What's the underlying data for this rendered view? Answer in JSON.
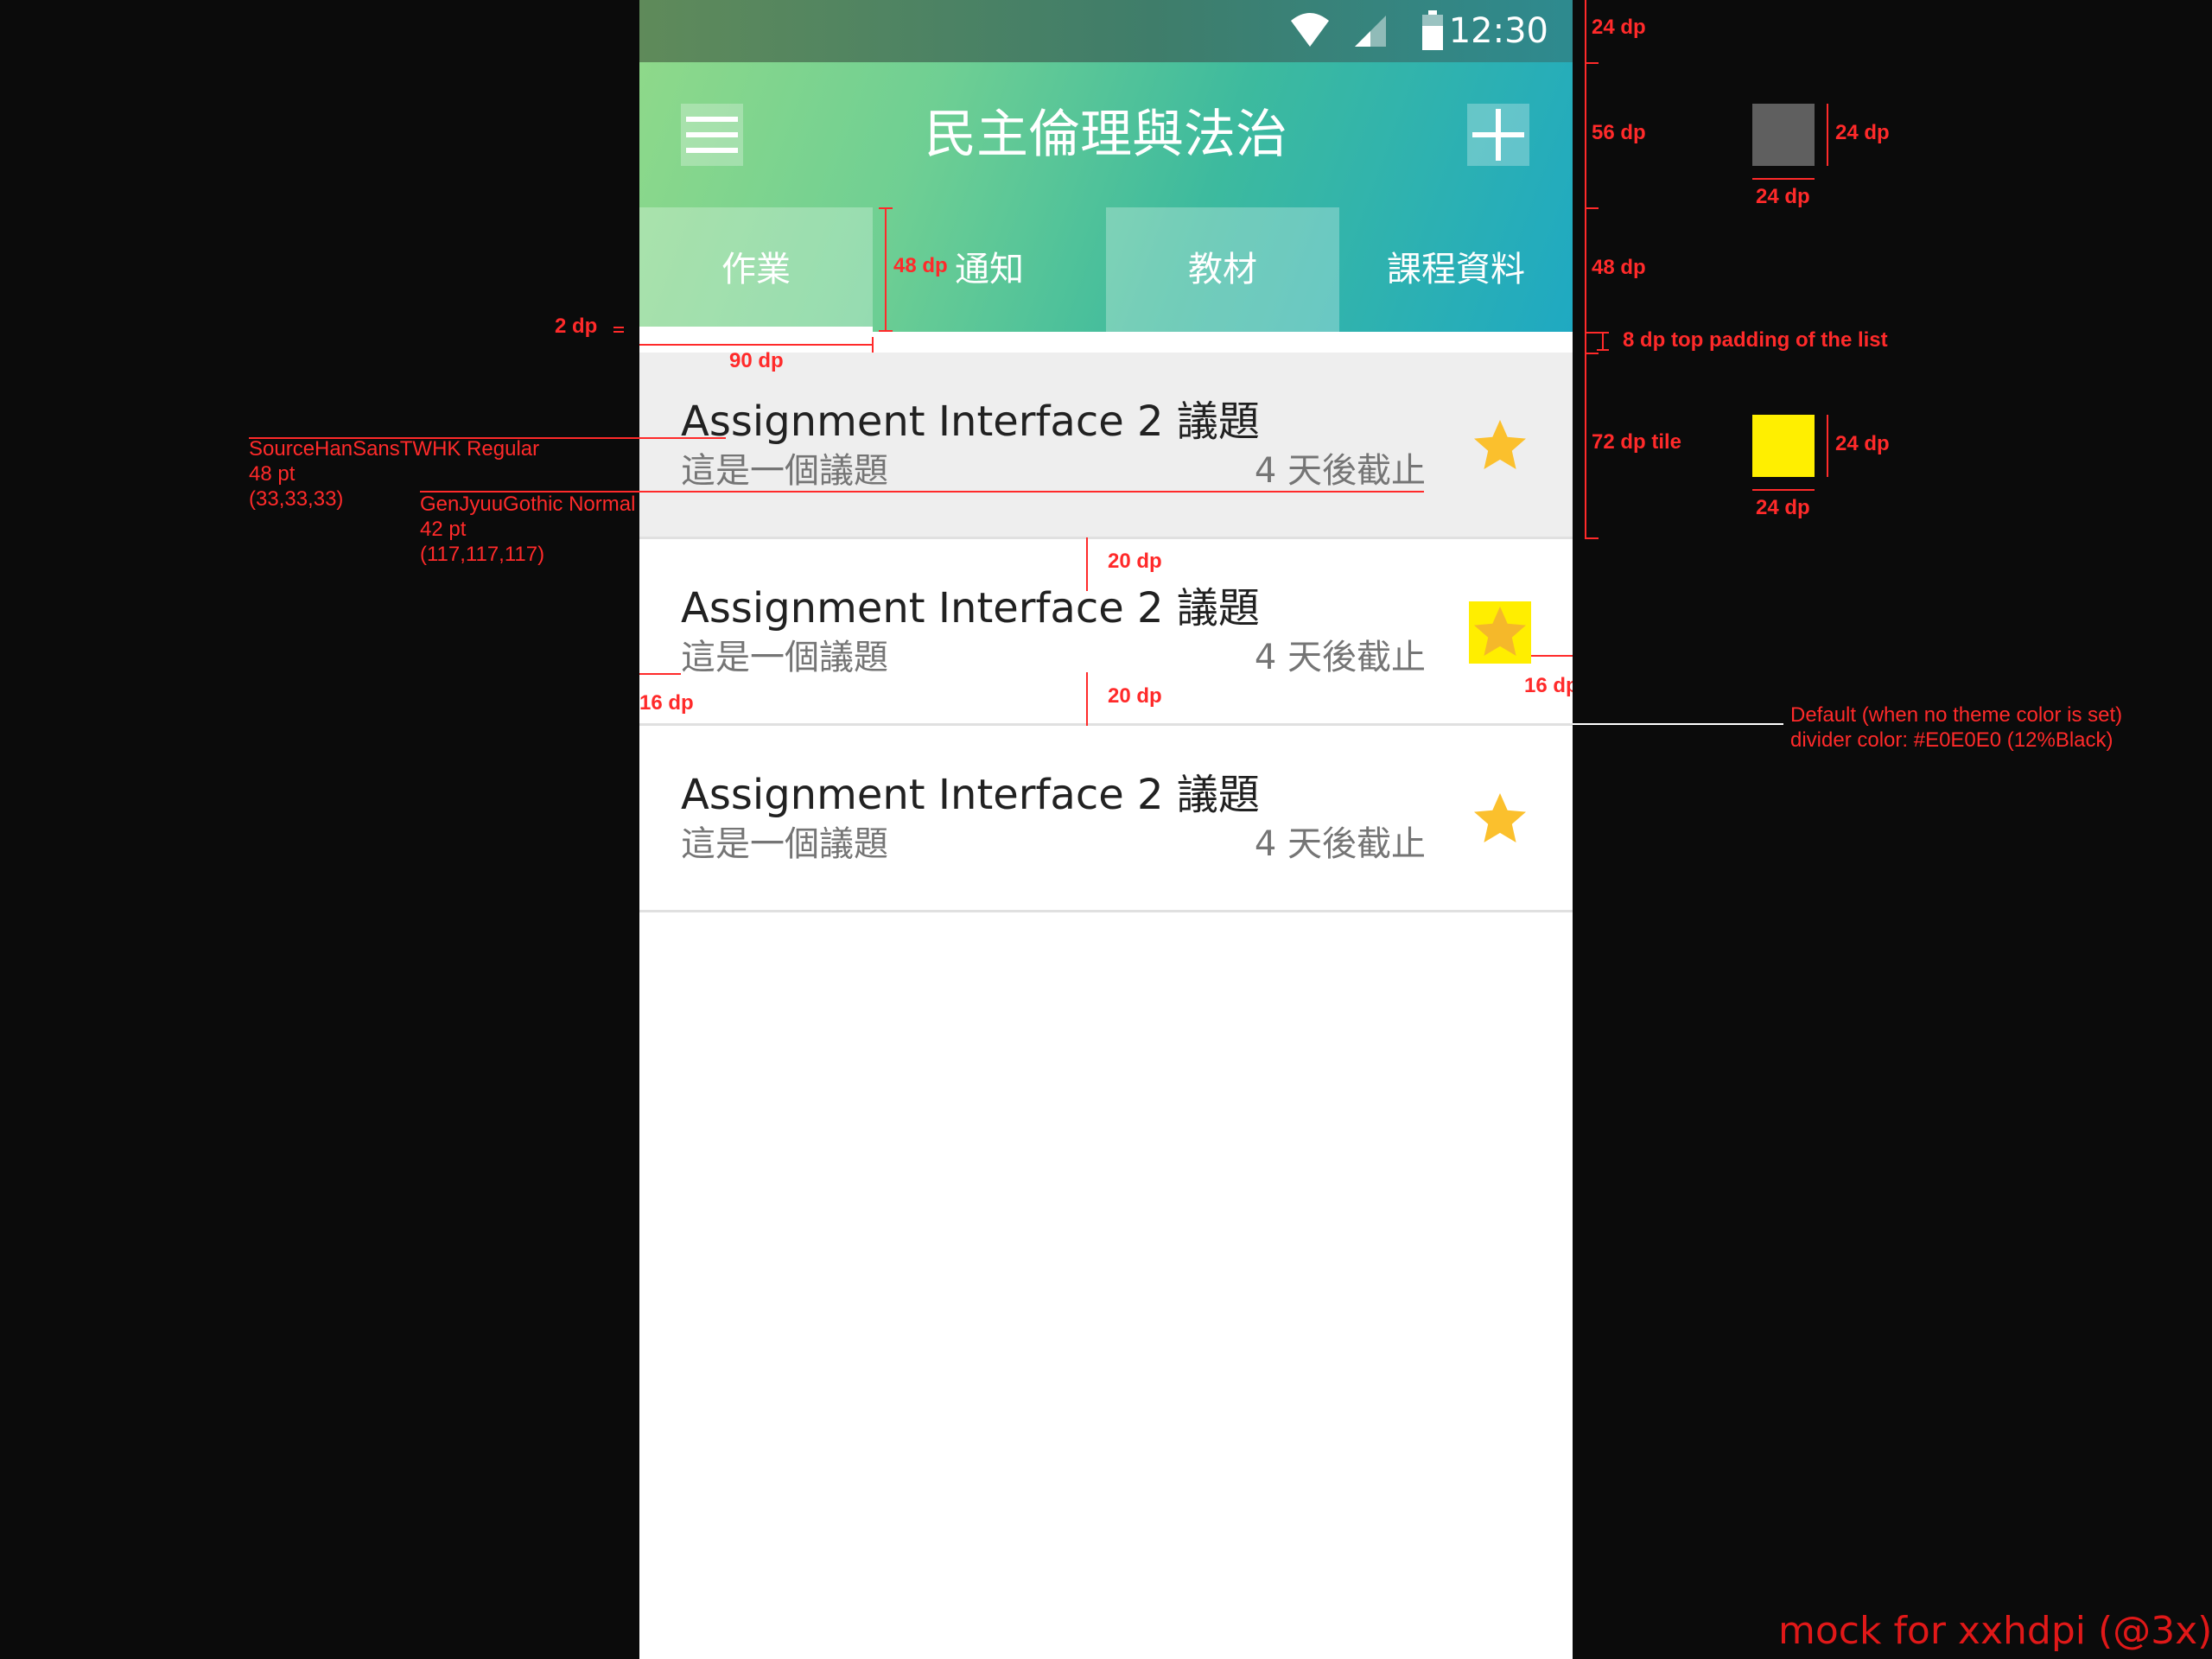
{
  "status_bar": {
    "time": "12:30",
    "icons": [
      "wifi-icon",
      "signal-icon",
      "battery-icon"
    ]
  },
  "app_bar": {
    "title": "民主倫理與法治",
    "menu_icon": "menu-icon",
    "add_icon": "add-icon"
  },
  "tabs": [
    {
      "label": "作業",
      "selected": true
    },
    {
      "label": "通知",
      "selected": false
    },
    {
      "label": "教材",
      "selected": false
    },
    {
      "label": "課程資料",
      "selected": false
    }
  ],
  "assignments": [
    {
      "title": "Assignment Interface 2 議題",
      "subtitle": "這是一個議題",
      "due": "4 天後截止",
      "starred": true,
      "pressed": true
    },
    {
      "title": "Assignment Interface 2 議題",
      "subtitle": "這是一個議題",
      "due": "4 天後截止",
      "starred": true,
      "pressed": false
    },
    {
      "title": "Assignment Interface 2 議題",
      "subtitle": "這是一個議題",
      "due": "4 天後截止",
      "starred": true,
      "pressed": false
    }
  ],
  "colors": {
    "star": "#FBC02D",
    "pressed_tile": "#EEEEEE",
    "divider": "#E0E0E0",
    "primary_text": "rgb(33,33,33)",
    "secondary_text": "rgb(117,117,117)",
    "redline": "#FF2A2A",
    "gradient_start": "#8ED98A",
    "gradient_end": "#1FA9C2"
  },
  "annotations": {
    "status_bar": "24 dp",
    "app_bar": "56 dp",
    "icon_size_h": "24 dp",
    "icon_size_w": "24 dp",
    "tab_height": "48 dp",
    "tab_height_inline": "48 dp",
    "indicator": "2 dp",
    "tab_width": "90 dp",
    "list_padding": "8 dp top padding of the list",
    "tile": "72 dp tile",
    "star_size_h": "24 dp",
    "star_size_w": "24 dp",
    "gap_top": "20 dp",
    "gap_bottom": "20 dp",
    "margin_left": "16 dp",
    "margin_right": "16 dp",
    "font1_name": "SourceHanSansTWHK Regular",
    "font1_size": "48 pt",
    "font1_color": "(33,33,33)",
    "font2_name": "GenJyuuGothic Normal",
    "font2_size": "42 pt",
    "font2_color": "(117,117,117)",
    "divider_line1": "Default (when no theme color is set)",
    "divider_line2": "divider color: #E0E0E0 (12%Black)",
    "mock": "mock for xxhdpi (@3x)"
  }
}
